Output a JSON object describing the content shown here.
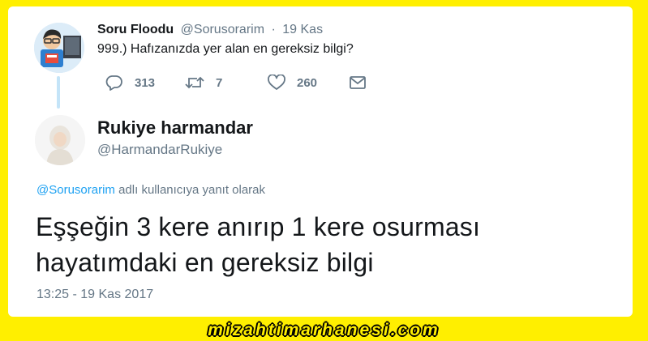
{
  "parent_tweet": {
    "name": "Soru Floodu",
    "handle": "@Sorusorarim",
    "separator": "·",
    "date": "19 Kas",
    "text": "999.) Hafızanızda yer alan en gereksiz bilgi?",
    "actions": {
      "reply_count": "313",
      "retweet_count": "7",
      "like_count": "260"
    },
    "icons": [
      "reply-icon",
      "retweet-icon",
      "like-icon",
      "message-icon"
    ]
  },
  "main_tweet": {
    "name": "Rukiye harmandar",
    "handle": "@HarmandarRukiye",
    "reply_to_mention": "@Sorusorarim",
    "reply_to_suffix": " adlı kullanıcıya yanıt olarak",
    "text": "Eşşeğin 3 kere anırıp 1 kere osurması hayatımdaki en gereksiz bilgi",
    "timestamp": "13:25 - 19 Kas 2017"
  },
  "watermark": "mizahtimarhanesi.com",
  "colors": {
    "background": "#ffef00",
    "card": "#ffffff",
    "text": "#14171a",
    "muted": "#657786",
    "link": "#1da1f2",
    "thread_line": "#c4e4f8"
  }
}
